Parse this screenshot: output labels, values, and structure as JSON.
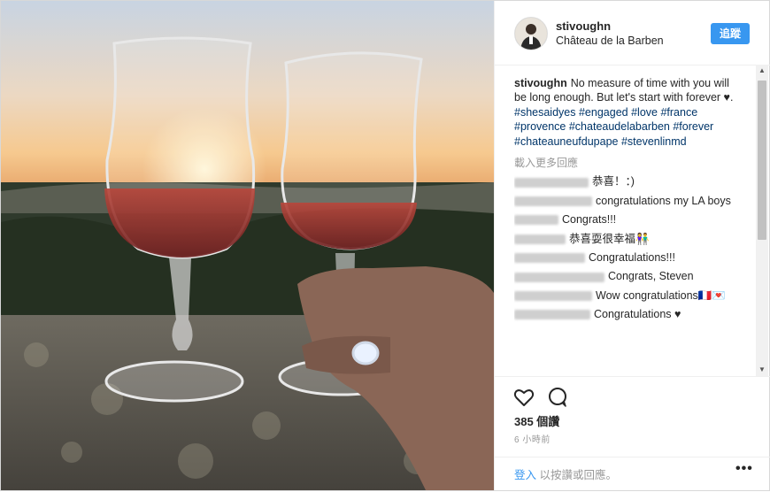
{
  "post": {
    "username": "stivoughn",
    "location": "Château de la Barben",
    "follow_label": "追蹤",
    "caption_text": "No measure of time with you will be long enough. But let's start with forever ♥.",
    "hashtags": [
      "#shesaidyes",
      "#engaged",
      "#love",
      "#france",
      "#provence",
      "#chateaudelabarben",
      "#forever",
      "#chateauneufdupape",
      "#stevenlinmd"
    ],
    "load_more": "載入更多回應",
    "comments": [
      {
        "text": "恭喜！：)"
      },
      {
        "text": "congratulations my LA boys"
      },
      {
        "text": "Congrats!!!"
      },
      {
        "text": "恭喜耍很幸福👫"
      },
      {
        "text": "Congratulations!!!"
      },
      {
        "text": "Congrats, Steven"
      },
      {
        "text": "Wow congratulations🇫🇷💌"
      },
      {
        "text": "Congratulations ♥"
      }
    ],
    "likes": "385 個讚",
    "time": "6 小時前",
    "login_link": "登入",
    "login_rest": " 以按讚或回應。",
    "more_label": "•••"
  },
  "colors": {
    "accent": "#3897f0",
    "hashtag": "#003569"
  },
  "icons": [
    "heart-icon",
    "comment-icon",
    "more-options-icon"
  ]
}
